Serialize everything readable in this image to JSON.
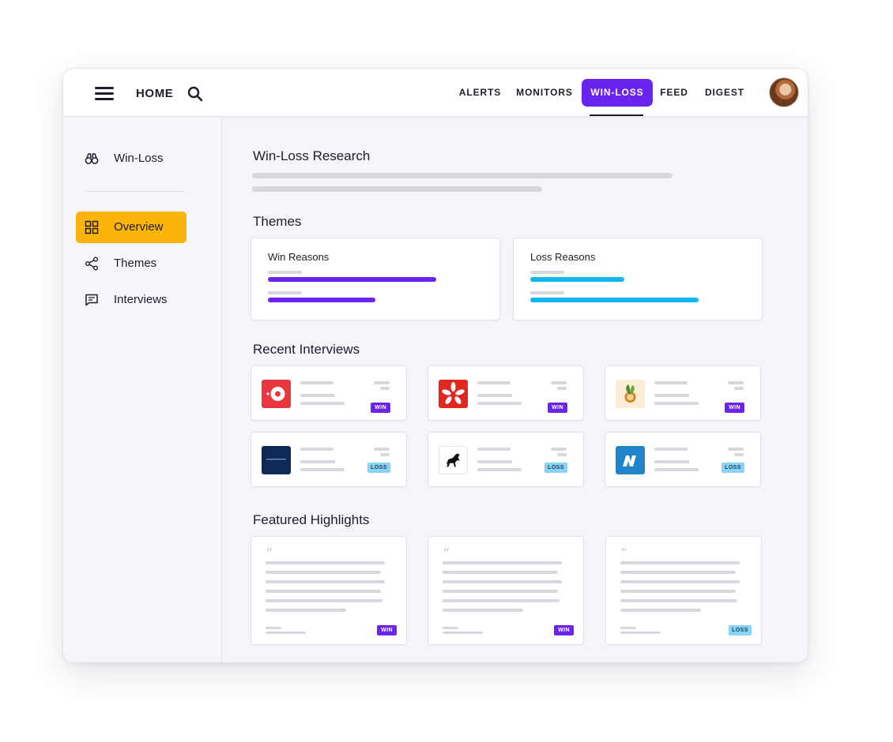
{
  "colors": {
    "accent": "#6a24ee",
    "sidebar_active": "#fbb40a",
    "loss_bar": "#12b6f0",
    "win_bar": "#6a24ee"
  },
  "topbar": {
    "home": "HOME",
    "nav": [
      "ALERTS",
      "MONITORS",
      "WIN-LOSS",
      "FEED",
      "DIGEST"
    ],
    "active_nav": "WIN-LOSS"
  },
  "sidebar": {
    "header": {
      "label": "Win-Loss",
      "icon": "binoculars-icon"
    },
    "items": [
      {
        "label": "Overview",
        "icon": "grid-icon",
        "active": true
      },
      {
        "label": "Themes",
        "icon": "share-nodes-icon",
        "active": false
      },
      {
        "label": "Interviews",
        "icon": "chat-icon",
        "active": false
      }
    ]
  },
  "main": {
    "title": "Win-Loss Research",
    "themes_heading": "Themes",
    "themes": [
      {
        "title": "Win Reasons",
        "bars": [
          0.75,
          0.48
        ]
      },
      {
        "title": "Loss Reasons",
        "bars": [
          0.42,
          0.75
        ]
      }
    ],
    "recent_heading": "Recent Interviews",
    "interviews": [
      {
        "logo": "red-target-logo",
        "result": "WIN"
      },
      {
        "logo": "yelp-burst-logo",
        "result": "WIN"
      },
      {
        "logo": "green-leaf-logo",
        "result": "WIN"
      },
      {
        "logo": "navy-bank-logo",
        "result": "LOSS"
      },
      {
        "logo": "black-horse-logo",
        "result": "LOSS"
      },
      {
        "logo": "blue-n-logo",
        "result": "LOSS"
      }
    ],
    "highlights_heading": "Featured Highlights",
    "highlights": [
      {
        "result": "WIN"
      },
      {
        "result": "WIN"
      },
      {
        "result": "LOSS"
      }
    ]
  }
}
